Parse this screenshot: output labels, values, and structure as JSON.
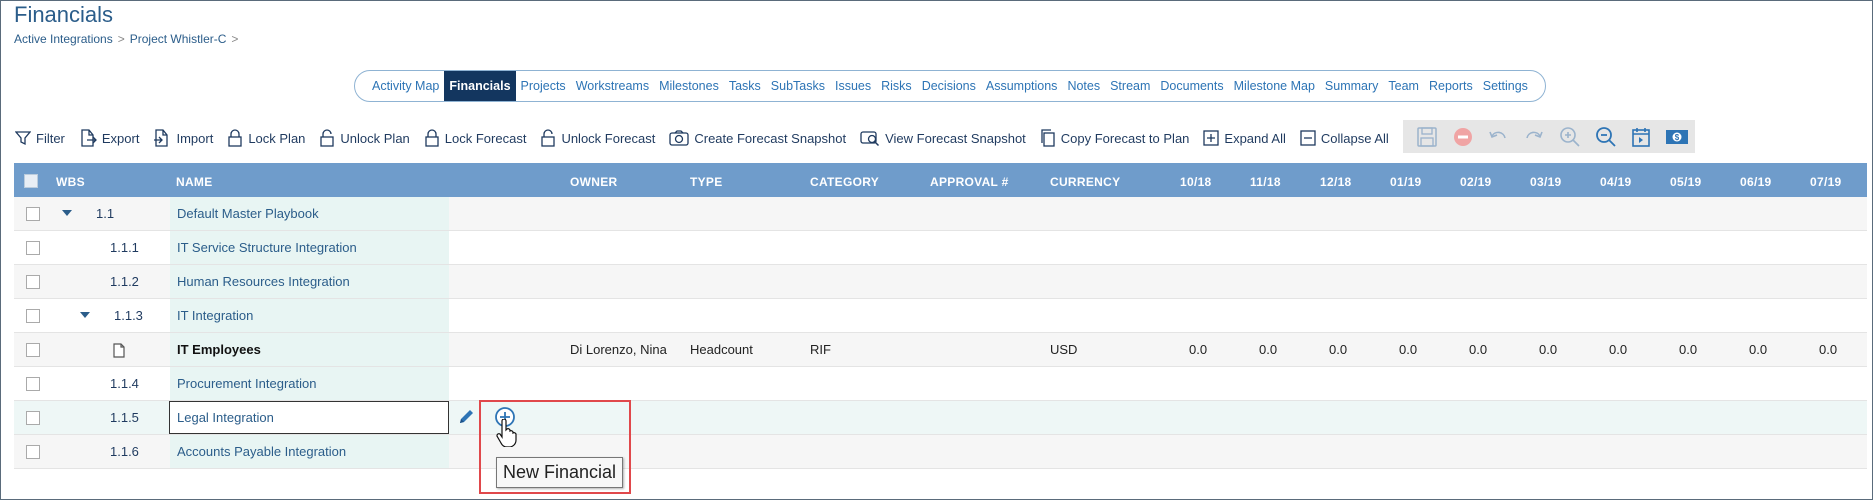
{
  "page": {
    "title": "Financials"
  },
  "breadcrumb": {
    "items": [
      "Active Integrations",
      "Project Whistler-C"
    ],
    "separator": ">"
  },
  "tabs": [
    {
      "label": "Activity Map",
      "active": false
    },
    {
      "label": "Financials",
      "active": true
    },
    {
      "label": "Projects",
      "active": false
    },
    {
      "label": "Workstreams",
      "active": false
    },
    {
      "label": "Milestones",
      "active": false
    },
    {
      "label": "Tasks",
      "active": false
    },
    {
      "label": "SubTasks",
      "active": false
    },
    {
      "label": "Issues",
      "active": false
    },
    {
      "label": "Risks",
      "active": false
    },
    {
      "label": "Decisions",
      "active": false
    },
    {
      "label": "Assumptions",
      "active": false
    },
    {
      "label": "Notes",
      "active": false
    },
    {
      "label": "Stream",
      "active": false
    },
    {
      "label": "Documents",
      "active": false
    },
    {
      "label": "Milestone Map",
      "active": false
    },
    {
      "label": "Summary",
      "active": false
    },
    {
      "label": "Team",
      "active": false
    },
    {
      "label": "Reports",
      "active": false
    },
    {
      "label": "Settings",
      "active": false
    }
  ],
  "toolbar": {
    "filter": "Filter",
    "export": "Export",
    "import": "Import",
    "lock_plan": "Lock Plan",
    "unlock_plan": "Unlock Plan",
    "lock_forecast": "Lock Forecast",
    "unlock_forecast": "Unlock Forecast",
    "create_snapshot": "Create Forecast Snapshot",
    "view_snapshot": "View Forecast Snapshot",
    "copy_forecast": "Copy Forecast to Plan",
    "expand_all": "Expand All",
    "collapse_all": "Collapse All"
  },
  "iconbar": [
    "save-icon",
    "delete-icon",
    "undo-icon",
    "redo-icon",
    "zoom-in-icon",
    "zoom-out-icon",
    "calendar-icon",
    "currency-icon"
  ],
  "grid": {
    "columns": {
      "wbs": "WBS",
      "name": "NAME",
      "owner": "OWNER",
      "type": "TYPE",
      "category": "CATEGORY",
      "approval": "APPROVAL #",
      "currency": "CURRENCY",
      "months": [
        "10/18",
        "11/18",
        "12/18",
        "01/19",
        "02/19",
        "03/19",
        "04/19",
        "05/19",
        "06/19",
        "07/19"
      ]
    },
    "rows": [
      {
        "wbs": "1.1",
        "name": "Default Master Playbook",
        "expanded": true
      },
      {
        "wbs": "1.1.1",
        "name": "IT Service Structure Integration"
      },
      {
        "wbs": "1.1.2",
        "name": "Human Resources Integration"
      },
      {
        "wbs": "1.1.3",
        "name": "IT Integration",
        "expanded": true
      },
      {
        "wbs": "",
        "name": "IT Employees",
        "owner": "Di Lorenzo, Nina",
        "type": "Headcount",
        "category": "RIF",
        "currency": "USD",
        "months": [
          "0.0",
          "0.0",
          "0.0",
          "0.0",
          "0.0",
          "0.0",
          "0.0",
          "0.0",
          "0.0",
          "0.0"
        ]
      },
      {
        "wbs": "1.1.4",
        "name": "Procurement Integration"
      },
      {
        "wbs": "1.1.5",
        "name": "Legal Integration",
        "editing": true
      },
      {
        "wbs": "1.1.6",
        "name": "Accounts Payable Integration"
      }
    ]
  },
  "tooltip": {
    "text": "New Financial"
  },
  "colors": {
    "header": "#6f9ccb",
    "active_tab": "#13365f",
    "link": "#2d74b5",
    "highlight": "#e0484b"
  }
}
